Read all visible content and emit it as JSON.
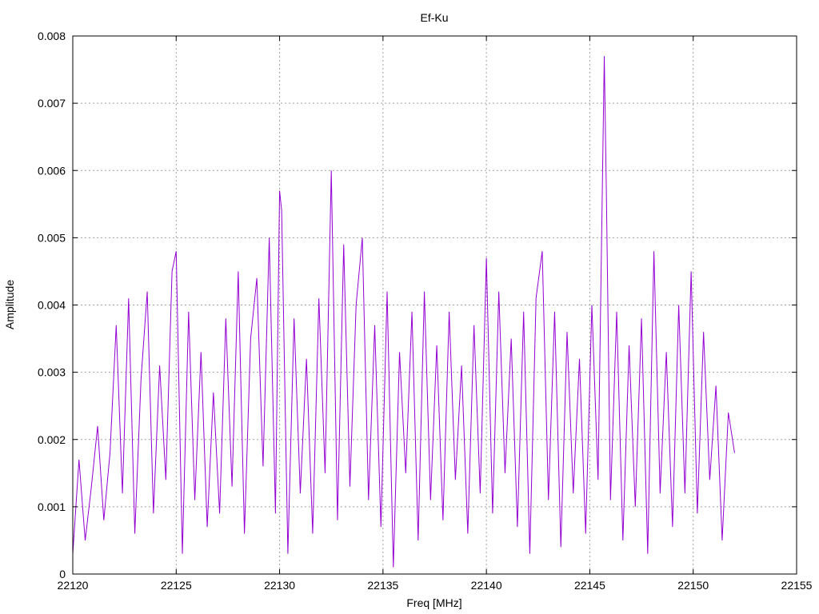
{
  "chart_data": {
    "type": "line",
    "title": "Ef-Ku",
    "xlabel": "Freq [MHz]",
    "ylabel": "Amplitude",
    "xlim": [
      22120,
      22155
    ],
    "ylim": [
      0,
      0.008
    ],
    "xticks": [
      22120,
      22125,
      22130,
      22135,
      22140,
      22145,
      22150,
      22155
    ],
    "yticks": [
      0,
      0.001,
      0.002,
      0.003,
      0.004,
      0.005,
      0.006,
      0.007,
      0.008
    ],
    "ytick_labels": [
      "0",
      "0.001",
      "0.002",
      "0.003",
      "0.004",
      "0.005",
      "0.006",
      "0.007",
      "0.008"
    ],
    "grid": true,
    "legend": "none",
    "series": [
      {
        "color": "#9400d3",
        "x": [
          22120.0,
          22120.3,
          22120.6,
          22120.9,
          22121.2,
          22121.5,
          22121.8,
          22122.1,
          22122.4,
          22122.7,
          22123.0,
          22123.3,
          22123.6,
          22123.9,
          22124.2,
          22124.5,
          22124.8,
          22125.0,
          22125.3,
          22125.6,
          22125.9,
          22126.2,
          22126.5,
          22126.8,
          22127.1,
          22127.4,
          22127.7,
          22128.0,
          22128.3,
          22128.6,
          22128.9,
          22129.2,
          22129.5,
          22129.8,
          22130.0,
          22130.1,
          22130.4,
          22130.7,
          22131.0,
          22131.3,
          22131.6,
          22131.9,
          22132.2,
          22132.5,
          22132.8,
          22133.1,
          22133.4,
          22133.7,
          22134.0,
          22134.3,
          22134.6,
          22134.9,
          22135.2,
          22135.5,
          22135.8,
          22136.1,
          22136.4,
          22136.7,
          22137.0,
          22137.3,
          22137.6,
          22137.9,
          22138.2,
          22138.5,
          22138.8,
          22139.1,
          22139.4,
          22139.7,
          22140.0,
          22140.3,
          22140.6,
          22140.9,
          22141.2,
          22141.5,
          22141.8,
          22142.1,
          22142.4,
          22142.7,
          22143.0,
          22143.3,
          22143.6,
          22143.9,
          22144.2,
          22144.5,
          22144.8,
          22145.1,
          22145.4,
          22145.7,
          22145.8,
          22146.0,
          22146.3,
          22146.6,
          22146.9,
          22147.2,
          22147.5,
          22147.8,
          22148.1,
          22148.4,
          22148.7,
          22149.0,
          22149.3,
          22149.6,
          22149.9,
          22150.2,
          22150.5,
          22150.8,
          22151.1,
          22151.4,
          22151.7,
          22152.0
        ],
        "y": [
          0.0003,
          0.0017,
          0.0005,
          0.0013,
          0.0022,
          0.0008,
          0.0018,
          0.0037,
          0.0012,
          0.0041,
          0.0006,
          0.0029,
          0.0042,
          0.0009,
          0.0031,
          0.0014,
          0.0045,
          0.0048,
          0.0003,
          0.0039,
          0.0011,
          0.0033,
          0.0007,
          0.0027,
          0.0009,
          0.0038,
          0.0013,
          0.0045,
          0.0006,
          0.0035,
          0.0044,
          0.0016,
          0.005,
          0.0009,
          0.0057,
          0.0054,
          0.0003,
          0.0038,
          0.0012,
          0.0032,
          0.0006,
          0.0041,
          0.0015,
          0.006,
          0.0008,
          0.0049,
          0.0013,
          0.004,
          0.005,
          0.0011,
          0.0037,
          0.0007,
          0.0042,
          0.0001,
          0.0033,
          0.0015,
          0.0039,
          0.0005,
          0.0042,
          0.0011,
          0.0034,
          0.0008,
          0.0039,
          0.0014,
          0.0031,
          0.0006,
          0.0037,
          0.0012,
          0.0047,
          0.0009,
          0.0042,
          0.0015,
          0.0035,
          0.0007,
          0.0039,
          0.0003,
          0.0041,
          0.0048,
          0.0011,
          0.0039,
          0.0004,
          0.0036,
          0.0012,
          0.0032,
          0.0006,
          0.004,
          0.0014,
          0.0077,
          0.0057,
          0.0011,
          0.0039,
          0.0005,
          0.0034,
          0.001,
          0.0038,
          0.0003,
          0.0048,
          0.0012,
          0.0033,
          0.0007,
          0.004,
          0.0012,
          0.0045,
          0.0009,
          0.0036,
          0.0014,
          0.0028,
          0.0005,
          0.0024,
          0.0018
        ]
      }
    ]
  }
}
